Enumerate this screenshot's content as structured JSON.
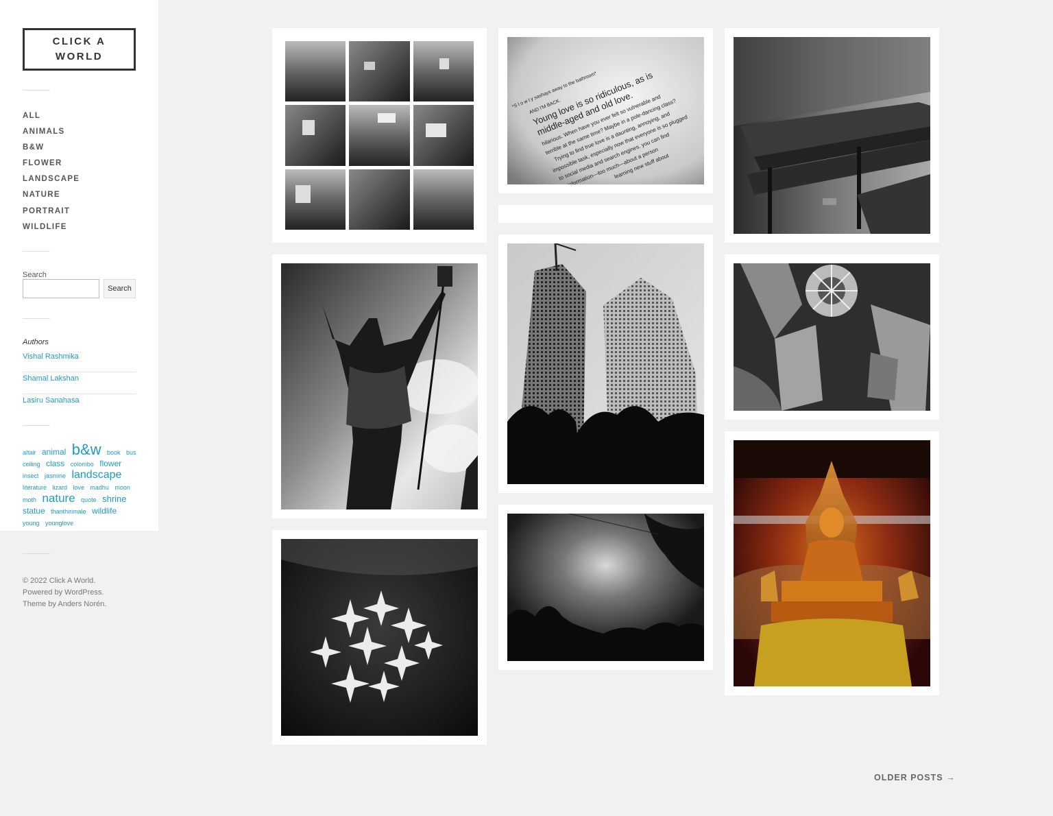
{
  "site": {
    "title": "CLICK A WORLD"
  },
  "nav": {
    "items": [
      {
        "label": "ALL"
      },
      {
        "label": "ANIMALS"
      },
      {
        "label": "B&W"
      },
      {
        "label": "FLOWER"
      },
      {
        "label": "LANDSCAPE"
      },
      {
        "label": "NATURE"
      },
      {
        "label": "PORTRAIT"
      },
      {
        "label": "WILDLIFE"
      }
    ]
  },
  "search": {
    "label": "Search",
    "placeholder": "",
    "value": "",
    "button": "Search"
  },
  "authors": {
    "title": "Authors",
    "items": [
      {
        "name": "Vishal Rashmika"
      },
      {
        "name": "Shamal Lakshan"
      },
      {
        "name": "Lasiru Sanahasa"
      }
    ]
  },
  "tags": [
    {
      "label": "altair",
      "size": 9
    },
    {
      "label": "animal",
      "size": 12
    },
    {
      "label": "b&w",
      "size": 22
    },
    {
      "label": "book",
      "size": 9
    },
    {
      "label": "bus",
      "size": 9
    },
    {
      "label": "ceiling",
      "size": 9
    },
    {
      "label": "class",
      "size": 12
    },
    {
      "label": "colombo",
      "size": 9
    },
    {
      "label": "flower",
      "size": 12
    },
    {
      "label": "insect",
      "size": 9
    },
    {
      "label": "jasmine",
      "size": 9
    },
    {
      "label": "landscape",
      "size": 16
    },
    {
      "label": "literature",
      "size": 9
    },
    {
      "label": "lizard",
      "size": 9
    },
    {
      "label": "love",
      "size": 9
    },
    {
      "label": "madhu",
      "size": 9
    },
    {
      "label": "moon",
      "size": 9
    },
    {
      "label": "moth",
      "size": 9
    },
    {
      "label": "nature",
      "size": 17
    },
    {
      "label": "quote",
      "size": 9
    },
    {
      "label": "shrine",
      "size": 13
    },
    {
      "label": "statue",
      "size": 12
    },
    {
      "label": "thanthirimale",
      "size": 9
    },
    {
      "label": "wildlife",
      "size": 12
    },
    {
      "label": "young",
      "size": 9
    },
    {
      "label": "younglove",
      "size": 9
    }
  ],
  "footer": {
    "copyright": "© 2022 Click A World.",
    "powered": "Powered by WordPress.",
    "theme": "Theme by Anders Norén."
  },
  "book_text": {
    "line1": "Young love is so ridiculous, as is",
    "line2": "middle-aged and old love.",
    "line3": "hilarious. When have you ever felt so vulnerable and",
    "line4": "terrible at the same time? Maybe in a pole-dancing class?",
    "line5": "Trying to find true love is a daunting, annoying, and",
    "line6": "impossible task, especially now that everyone is so plugged",
    "line7": "to social media and search engines. you can find",
    "line8": "information—too much—about a person",
    "line9": "learning new stuff about",
    "small1": "AND I'M BACK.",
    "small2": "*S l o w l y sashays away to the bathroom*"
  },
  "pagination": {
    "older": "OLDER POSTS →"
  },
  "colors": {
    "link": "#1e9bc0",
    "background": "#f1f1f1",
    "text": "#333333"
  }
}
